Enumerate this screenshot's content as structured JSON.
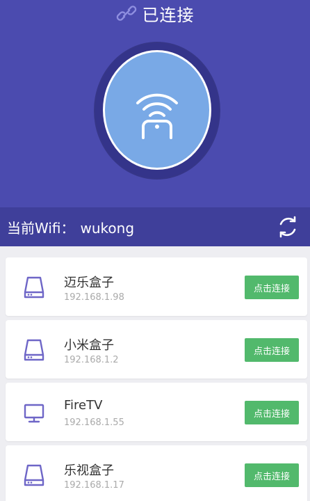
{
  "colors": {
    "header": "#4b4baf",
    "wifi_bar": "#3f3f9a",
    "circle": "#79a9e6",
    "button": "#52b96c",
    "icon": "#6e66c7"
  },
  "status": {
    "icon": "link-icon",
    "text": "已连接"
  },
  "connect_button": {
    "icon": "remote-wifi-icon"
  },
  "wifi": {
    "label": "当前Wifi：",
    "name": "wukong",
    "refresh_icon": "refresh-icon"
  },
  "devices": [
    {
      "icon": "tv-box-icon",
      "name": "迈乐盒子",
      "ip": "192.168.1.98",
      "button": "点击连接"
    },
    {
      "icon": "tv-box-icon",
      "name": "小米盒子",
      "ip": "192.168.1.2",
      "button": "点击连接"
    },
    {
      "icon": "monitor-icon",
      "name": "FireTV",
      "ip": "192.168.1.55",
      "button": "点击连接"
    },
    {
      "icon": "tv-box-icon",
      "name": "乐视盒子",
      "ip": "192.168.1.17",
      "button": "点击连接"
    }
  ]
}
